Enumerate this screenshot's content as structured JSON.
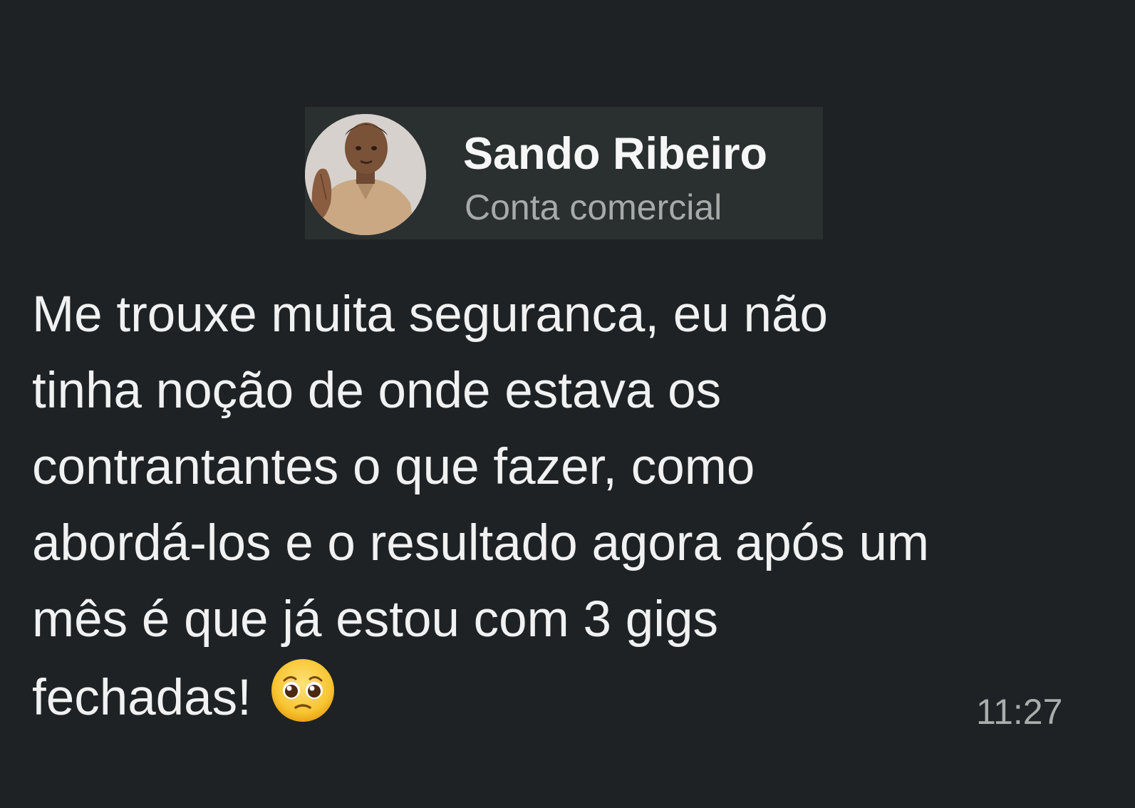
{
  "contact": {
    "name": "Sando Ribeiro",
    "subtitle": "Conta comercial",
    "avatar_icon": "profile-photo"
  },
  "message": {
    "lines": [
      "Me trouxe muita seguranca, eu não",
      "tinha noção de onde estava os",
      "contrantantes o que fazer, como",
      "abordá-los e o resultado agora após um",
      "mês é que já estou com 3 gigs",
      "fechadas!"
    ],
    "emoji": "pleading-face-emoji",
    "time": "11:27"
  },
  "colors": {
    "background": "#1e2224",
    "header_background": "#2a302f",
    "text": "#f1f1f1",
    "muted_text": "#a6aaa9"
  }
}
